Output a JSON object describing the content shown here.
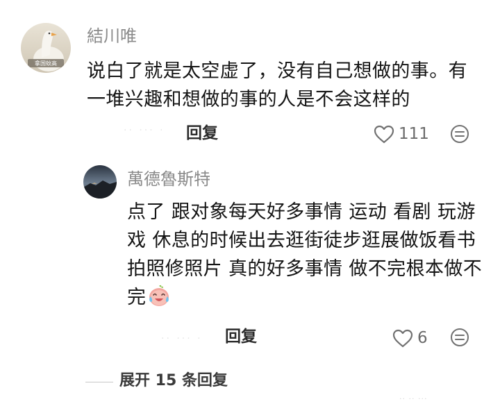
{
  "comment": {
    "author": "結川唯",
    "avatar_caption": "拿国蚊高",
    "text": "说白了就是太空虚了，没有自己想做的事。有一堆兴趣和想做的事的人是不会这样的",
    "meta": "·· ··· ·",
    "reply_label": "回复",
    "like_count": "111"
  },
  "reply": {
    "author": "萬德魯斯特",
    "text": "点了 跟对象每天好多事情 运动 看剧 玩游戏 休息的时候出去逛街徒步逛展做饭看书拍照修照片 真的好多事情 做不完根本做不完",
    "emoji": "laughing-crying-emoji",
    "meta": "·· ··· ·",
    "reply_label": "回复",
    "like_count": "6"
  },
  "expand_replies_label": "展开 15 条回复",
  "watermark": "·· ·· ···",
  "icons": {
    "like": "heart-outline-icon",
    "more": "dots-circle-icon"
  },
  "colors": {
    "username": "#8a8a8a",
    "text": "#141414",
    "icon": "#707070"
  }
}
